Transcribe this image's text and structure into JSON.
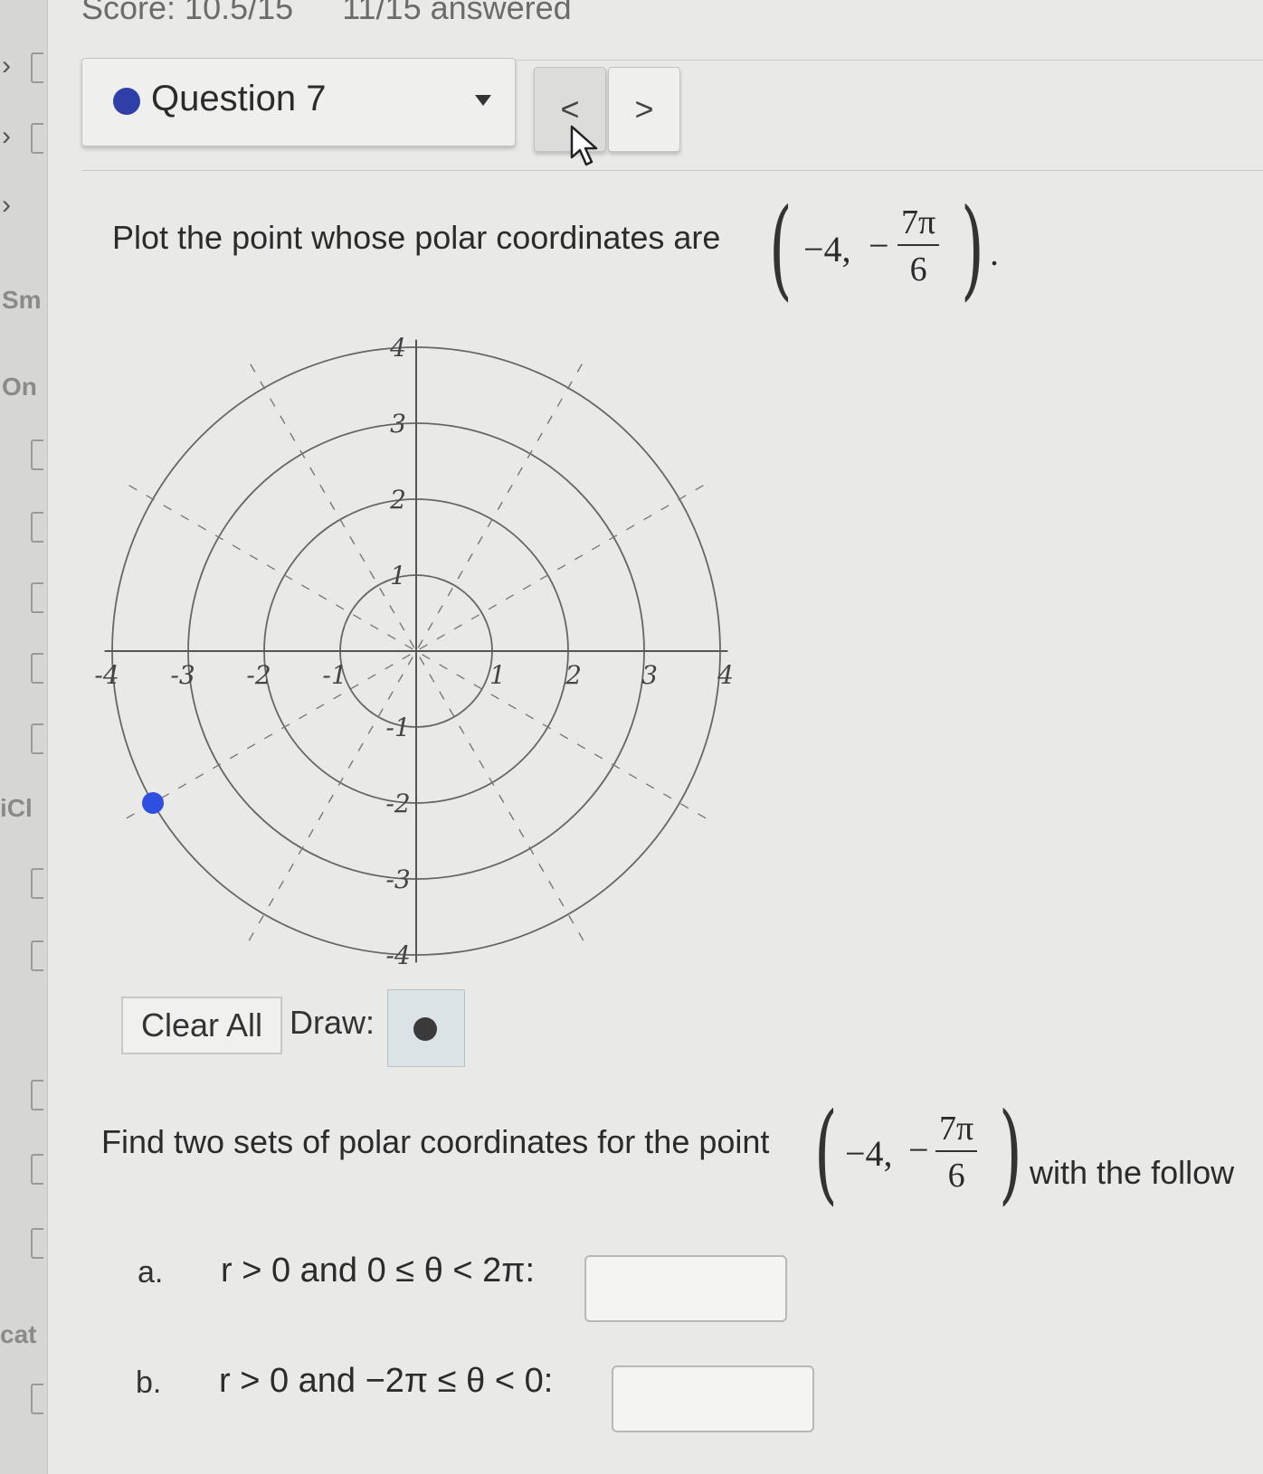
{
  "header": {
    "score": "Score: 10.5/15",
    "answered": "11/15 answered"
  },
  "question_nav": {
    "selected": "Question 7",
    "prev_label": "<",
    "next_label": ">"
  },
  "sidebar": {
    "labels": [
      "Sm",
      "On",
      "iCl",
      "cat"
    ]
  },
  "problem1": {
    "prompt": "Plot the point whose polar coordinates are",
    "r": "−4,",
    "theta_sign": "−",
    "theta_num": "7π",
    "theta_den": "6",
    "end": "."
  },
  "graph": {
    "x_ticks": [
      "-4",
      "-3",
      "-2",
      "-1",
      "1",
      "2",
      "3",
      "4"
    ],
    "y_ticks": [
      "4",
      "3",
      "2",
      "1",
      "-1",
      "-2",
      "-3",
      "-4"
    ],
    "plotted_point": {
      "r": 4,
      "theta_deg": 210
    },
    "point_color": "#2f4fe0"
  },
  "tools": {
    "clear_label": "Clear All",
    "draw_label": "Draw:",
    "draw_tool": "point-icon"
  },
  "problem2": {
    "prompt": "Find two sets of polar coordinates for the point",
    "r": "−4,",
    "theta_sign": "−",
    "theta_num": "7π",
    "theta_den": "6",
    "suffix": "with the follow"
  },
  "parts": [
    {
      "label": "a.",
      "condition": "r > 0 and 0 ≤ θ < 2π:",
      "value": ""
    },
    {
      "label": "b.",
      "condition": "r > 0 and −2π ≤ θ < 0:",
      "value": ""
    }
  ]
}
